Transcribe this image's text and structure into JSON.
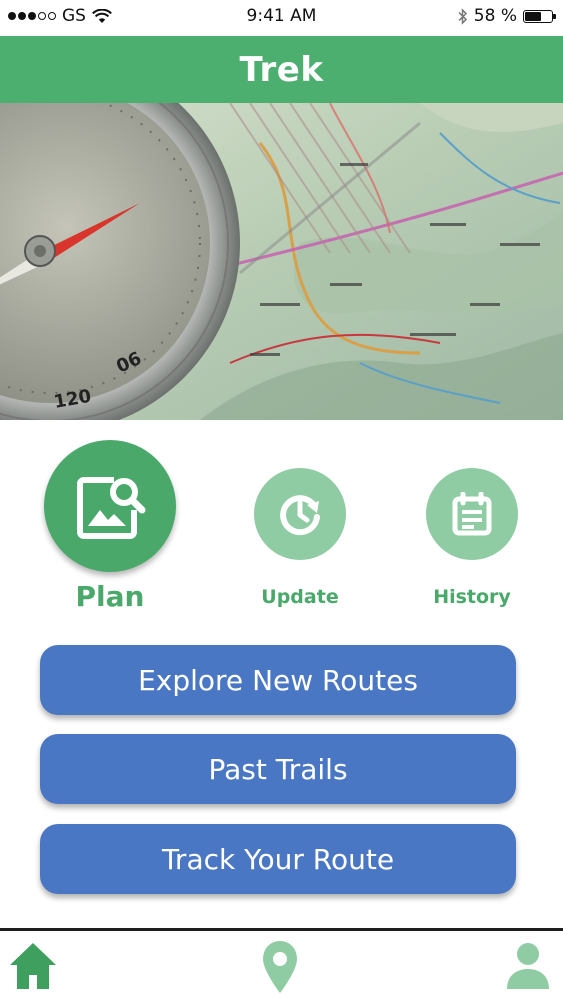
{
  "status_bar": {
    "carrier": "GS",
    "time": "9:41 AM",
    "battery_percent": "58 %",
    "battery_level": 0.58,
    "signal_bars_filled": 3,
    "signal_bars_total": 5
  },
  "header": {
    "title": "Trek",
    "color": "#4caf6f"
  },
  "hero": {
    "image_description_icon": "map-with-compass-image"
  },
  "actions": {
    "plan": {
      "label": "Plan",
      "icon": "image-search-icon"
    },
    "update": {
      "label": "Update",
      "icon": "clock-refresh-icon"
    },
    "history": {
      "label": "History",
      "icon": "calendar-list-icon"
    }
  },
  "buttons": {
    "explore": "Explore New Routes",
    "past_trails": "Past Trails",
    "track": "Track Your Route"
  },
  "tabs": [
    {
      "icon": "home-icon",
      "active": true
    },
    {
      "icon": "location-pin-icon",
      "active": false
    },
    {
      "icon": "user-icon",
      "active": false
    }
  ],
  "colors": {
    "accent_green": "#4aa96a",
    "light_green": "#8fcca3",
    "button_blue": "#4a77c4"
  }
}
